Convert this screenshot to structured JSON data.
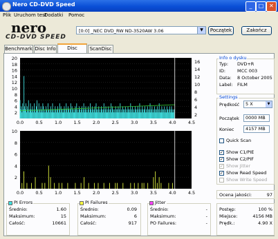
{
  "window": {
    "title": "Nero CD-DVD Speed",
    "min": "_",
    "max": "□",
    "close": "✕"
  },
  "menu": [
    "Plik",
    "Uruchom test",
    "Dodatki",
    "Pomoc"
  ],
  "logo": {
    "brand": "nero",
    "product": "CD-DVD SPEED"
  },
  "drive": {
    "selected": "[0:0]  _NEC DVD_RW ND-3520AW 3.06"
  },
  "buttons": {
    "start": "Początek",
    "stop": "Zakończ"
  },
  "tabs": [
    "Benchmark",
    "Disc Info",
    "Disc Quality",
    "ScanDisc"
  ],
  "active_tab": "Disc Quality",
  "disc_info": {
    "title": "Info o dysku",
    "type_label": "Typ:",
    "type": "DVD+R",
    "id_label": "ID:",
    "id": "MCC 003",
    "date_label": "Data:",
    "date": "8 October 2005",
    "label_label": "Label:",
    "label": "FILM"
  },
  "settings": {
    "title": "Settings",
    "speed_label": "Prędkość",
    "speed": "5 X",
    "start_label": "Początek",
    "start": "0000 MB",
    "end_label": "Koniec",
    "end": "4157 MB",
    "quick_scan": "Quick Scan",
    "show_c1pie": "Show C1/PIE",
    "show_c2pif": "Show C2/PIF",
    "show_jitter": "Show Jitter",
    "show_read_speed": "Show Read Speed",
    "show_write_speed": "Show Write Speed"
  },
  "quality": {
    "label": "Ocena jakości:",
    "value": "97"
  },
  "pi_errors": {
    "title": "PI Errors",
    "avg_label": "Średnio:",
    "avg": "1.60",
    "max_label": "Maksimum:",
    "max": "15",
    "total_label": "Całość:",
    "total": "10661"
  },
  "pi_failures": {
    "title": "PI Failures",
    "avg_label": "Średnio:",
    "avg": "0.09",
    "max_label": "Maksimum:",
    "max": "6",
    "total_label": "Całość:",
    "total": "917"
  },
  "jitter": {
    "title": "Jitter",
    "avg_label": "Średnio:",
    "avg": "-",
    "max_label": "Maksimum:",
    "max": "-",
    "po_label": "PO Failures:",
    "po": "-"
  },
  "progress": {
    "progress_label": "Postęp:",
    "progress": "100 %",
    "place_label": "Miejsce:",
    "place": "4156 MB",
    "speed_label": "Prędk.:",
    "speed": "4.90 X"
  },
  "colors": {
    "chart_bg": "#000000",
    "pie_bar": "#40e0e0",
    "pif_bar": "#c8d838",
    "read_speed": "#30c030",
    "pif_swatch": "#ffff40",
    "jitter_swatch": "#ff40ff"
  },
  "chart_data": [
    {
      "type": "bar",
      "title": "PI Errors",
      "x_ticks": [
        "0.0",
        "0.5",
        "1.0",
        "1.5",
        "2.0",
        "2.5",
        "3.0",
        "3.5",
        "4.0",
        "4.5"
      ],
      "y_ticks_left": [
        "20",
        "18",
        "16",
        "14",
        "12",
        "10",
        "8",
        "6",
        "4",
        "2"
      ],
      "y_ticks_right": [
        "16",
        "14",
        "12",
        "10",
        "8",
        "6",
        "4",
        "2"
      ],
      "xlim": [
        0,
        4.5
      ],
      "ylim": [
        0,
        20
      ],
      "pie_values": [
        6,
        3,
        4,
        2,
        5,
        3,
        14,
        4,
        3,
        5,
        2,
        4,
        3,
        6,
        2,
        3,
        5,
        3,
        2,
        4,
        3,
        2,
        5,
        3,
        2,
        4,
        6,
        3,
        2,
        5,
        3,
        2,
        4,
        3,
        2,
        5,
        4,
        2,
        3,
        2,
        4,
        3,
        2,
        5,
        3,
        2,
        3,
        4,
        2,
        3,
        5,
        2,
        3,
        2,
        4,
        3,
        2,
        3,
        4,
        2,
        3,
        5,
        2,
        4,
        3,
        2,
        3,
        2,
        4,
        3,
        2,
        5,
        3,
        2,
        4,
        3,
        2,
        3,
        5,
        2,
        4,
        3,
        2,
        3,
        2,
        4,
        3,
        5,
        2,
        3,
        2,
        4,
        3,
        2,
        3,
        4,
        2,
        3,
        5,
        2,
        3,
        4,
        2,
        3,
        2,
        4,
        3,
        2,
        5,
        3,
        2,
        4,
        3,
        2,
        3,
        4,
        2,
        5,
        3,
        2,
        3,
        4,
        2,
        3,
        2,
        4,
        3,
        2,
        3,
        5,
        2,
        3,
        4,
        2,
        3,
        2,
        4,
        3,
        2,
        3,
        5,
        2,
        4,
        3,
        2,
        3,
        2,
        4,
        3,
        2,
        3,
        4,
        2,
        3,
        5,
        2,
        3,
        2,
        4,
        3,
        2,
        3,
        4,
        2,
        3,
        2,
        4,
        3,
        2,
        3,
        5,
        2,
        3,
        4,
        2,
        3,
        2,
        4,
        3,
        2,
        3,
        4,
        2,
        3,
        5,
        2,
        3,
        2,
        4,
        3,
        2,
        3,
        4,
        2,
        3,
        2,
        4,
        3,
        2,
        3,
        5,
        2,
        3,
        4,
        2,
        3,
        2,
        4,
        3,
        2,
        3,
        4,
        2,
        3,
        5,
        2,
        3,
        2,
        4,
        3,
        2,
        3,
        4,
        2,
        3,
        2,
        4,
        3,
        2,
        3,
        4,
        2,
        3,
        4,
        2,
        3,
        2,
        3
      ],
      "read_speed": [
        [
          0,
          2.1
        ],
        [
          0.5,
          2.2
        ],
        [
          1.0,
          2.4
        ],
        [
          1.5,
          2.6
        ],
        [
          2.0,
          2.8
        ],
        [
          2.5,
          3.0
        ],
        [
          3.0,
          3.2
        ],
        [
          3.5,
          3.4
        ],
        [
          4.0,
          3.6
        ],
        [
          4.06,
          3.6
        ]
      ]
    },
    {
      "type": "bar",
      "title": "PI Failures",
      "x_ticks": [
        "0.0",
        "0.5",
        "1.0",
        "1.5",
        "2.0",
        "2.5",
        "3.0",
        "3.5",
        "4.0",
        "4.5"
      ],
      "y_ticks_left": [
        "10",
        "8",
        "6",
        "4",
        "2"
      ],
      "xlim": [
        0,
        4.5
      ],
      "ylim": [
        0,
        10
      ],
      "pif_values": [
        [
          0.05,
          1
        ],
        [
          0.1,
          3
        ],
        [
          0.18,
          1
        ],
        [
          0.3,
          1
        ],
        [
          0.4,
          2
        ],
        [
          0.58,
          1
        ],
        [
          0.65,
          1
        ],
        [
          0.75,
          4
        ],
        [
          0.8,
          2
        ],
        [
          0.9,
          1
        ],
        [
          1.02,
          1
        ],
        [
          1.1,
          1
        ],
        [
          1.25,
          1
        ],
        [
          1.45,
          1
        ],
        [
          1.6,
          1
        ],
        [
          1.68,
          2
        ],
        [
          1.8,
          1
        ],
        [
          1.95,
          1
        ],
        [
          2.05,
          1
        ],
        [
          2.2,
          1
        ],
        [
          2.35,
          1
        ],
        [
          2.5,
          1
        ],
        [
          2.55,
          1
        ],
        [
          2.7,
          1
        ],
        [
          2.9,
          1
        ],
        [
          3.0,
          1
        ],
        [
          3.1,
          1
        ],
        [
          3.2,
          1
        ],
        [
          3.25,
          1
        ],
        [
          3.35,
          1
        ],
        [
          3.5,
          2
        ],
        [
          3.55,
          3
        ],
        [
          3.6,
          1
        ],
        [
          3.65,
          2
        ],
        [
          3.7,
          1
        ],
        [
          3.9,
          1
        ],
        [
          4.0,
          1
        ]
      ],
      "marker_x": 4.06
    }
  ]
}
